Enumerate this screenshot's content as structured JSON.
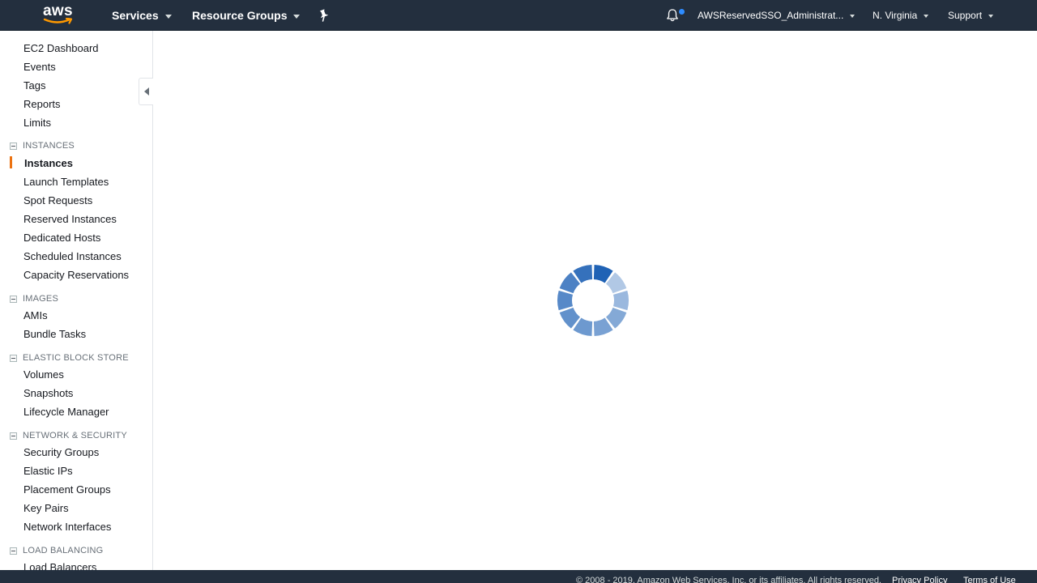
{
  "topnav": {
    "logo_text": "aws",
    "services_label": "Services",
    "resource_groups_label": "Resource Groups",
    "account_label": "AWSReservedSSO_Administrat...",
    "region_label": "N. Virginia",
    "support_label": "Support"
  },
  "sidebar": {
    "top_items": [
      "EC2 Dashboard",
      "Events",
      "Tags",
      "Reports",
      "Limits"
    ],
    "sections": [
      {
        "title": "INSTANCES",
        "items": [
          "Instances",
          "Launch Templates",
          "Spot Requests",
          "Reserved Instances",
          "Dedicated Hosts",
          "Scheduled Instances",
          "Capacity Reservations"
        ]
      },
      {
        "title": "IMAGES",
        "items": [
          "AMIs",
          "Bundle Tasks"
        ]
      },
      {
        "title": "ELASTIC BLOCK STORE",
        "items": [
          "Volumes",
          "Snapshots",
          "Lifecycle Manager"
        ]
      },
      {
        "title": "NETWORK & SECURITY",
        "items": [
          "Security Groups",
          "Elastic IPs",
          "Placement Groups",
          "Key Pairs",
          "Network Interfaces"
        ]
      },
      {
        "title": "LOAD BALANCING",
        "items": [
          "Load Balancers"
        ]
      }
    ],
    "active_item": "Instances"
  },
  "footer": {
    "copyright": "© 2008 - 2019, Amazon Web Services, Inc. or its affiliates. All rights reserved.",
    "privacy_label": "Privacy Policy",
    "terms_label": "Terms of Use"
  },
  "colors": {
    "nav_bg": "#232f3e",
    "accent_orange": "#ec7211",
    "notification_blue": "#2e8cff",
    "spinner_blue": "#1f62b5"
  },
  "icons": {
    "pin": "pin-icon",
    "bell": "bell-icon",
    "collapse": "collapse-arrow-icon",
    "loading": "loading-spinner-icon"
  }
}
